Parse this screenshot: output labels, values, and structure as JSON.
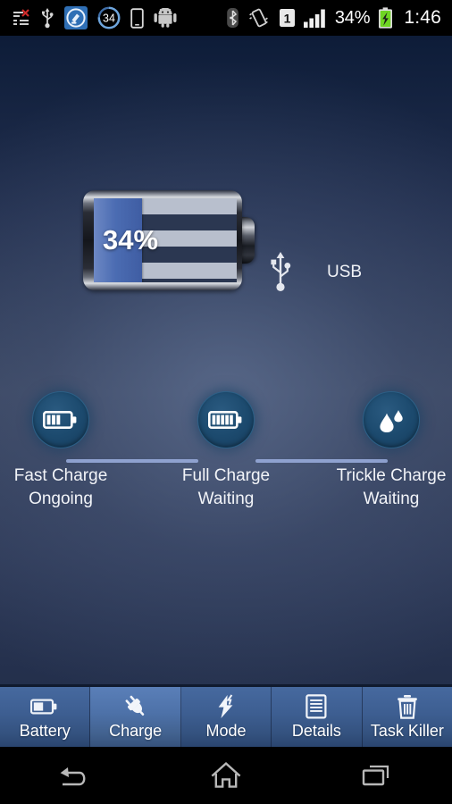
{
  "statusbar": {
    "left_icons": [
      {
        "name": "sync-error-icon"
      },
      {
        "name": "usb-icon"
      },
      {
        "name": "cleaner-app-icon"
      },
      {
        "name": "battery-34-circle-icon",
        "value": "34"
      },
      {
        "name": "smartphone-icon"
      },
      {
        "name": "android-robot-icon"
      }
    ],
    "right_icons": [
      {
        "name": "bluetooth-icon"
      },
      {
        "name": "vibrate-icon"
      },
      {
        "name": "sim-1-icon",
        "value": "1"
      },
      {
        "name": "signal-bars-icon"
      }
    ],
    "battery_percent": "34%",
    "charging_icon": "battery-charging-icon",
    "clock": "1:46"
  },
  "hero": {
    "battery_percent_label": "34%",
    "battery_level": 34,
    "power_source_icon": "usb-icon",
    "power_source_label": "USB"
  },
  "stages": [
    {
      "icon": "battery-half-icon",
      "title": "Fast Charge",
      "status": "Ongoing"
    },
    {
      "icon": "battery-full-icon",
      "title": "Full Charge",
      "status": "Waiting"
    },
    {
      "icon": "water-droplets-icon",
      "title": "Trickle Charge",
      "status": "Waiting"
    }
  ],
  "toolbar": {
    "tabs": [
      {
        "icon": "battery-icon",
        "label": "Battery",
        "selected": false
      },
      {
        "icon": "power-plug-icon",
        "label": "Charge",
        "selected": true
      },
      {
        "icon": "lightning-bolt-icon",
        "label": "Mode",
        "selected": false
      },
      {
        "icon": "document-lines-icon",
        "label": "Details",
        "selected": false
      },
      {
        "icon": "trash-can-icon",
        "label": "Task Killer",
        "selected": false
      }
    ]
  },
  "navbar": {
    "buttons": [
      {
        "icon": "back-arrow-icon",
        "label": "Back"
      },
      {
        "icon": "home-icon",
        "label": "Home"
      },
      {
        "icon": "recents-icon",
        "label": "Recent apps"
      }
    ]
  },
  "colors": {
    "accent_blue": "#4b6cb2",
    "stage_circle": "#1c4a6e",
    "stage_line": "#8fa2d0",
    "toolbar": "#3d5e91",
    "bg_top": "#0d1c38",
    "bg_mid": "#485874"
  }
}
